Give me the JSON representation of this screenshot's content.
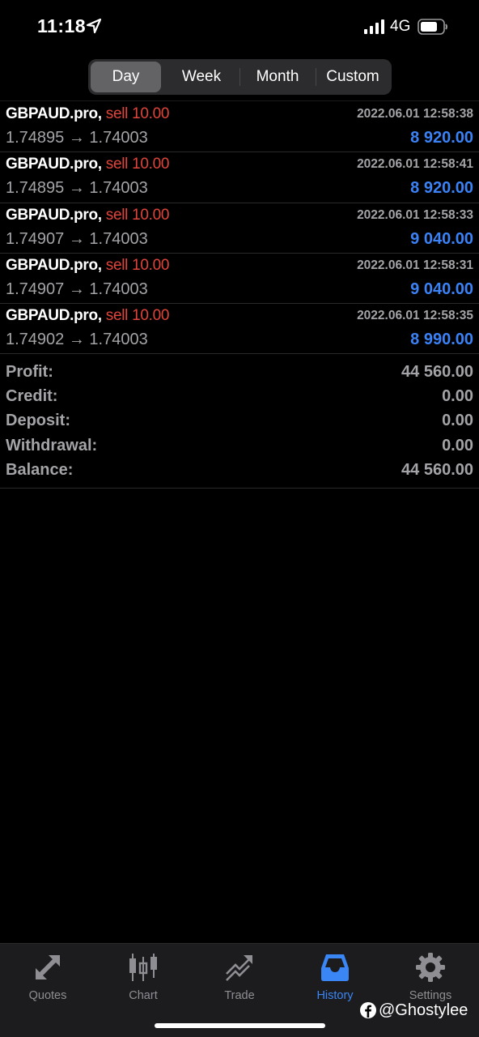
{
  "status_bar": {
    "time": "11:18",
    "network": "4G",
    "icons": [
      "location-arrow-icon",
      "cellular-signal-icon",
      "battery-icon"
    ]
  },
  "period_tabs": [
    "Day",
    "Week",
    "Month",
    "Custom"
  ],
  "period_selected": "Day",
  "trades": [
    {
      "symbol": "GBPAUD.pro,",
      "side": "sell 10.00",
      "time": "2022.06.01 12:58:38",
      "prices": "1.74895 → 1.74003",
      "profit": "8 920.00"
    },
    {
      "symbol": "GBPAUD.pro,",
      "side": "sell 10.00",
      "time": "2022.06.01 12:58:41",
      "prices": "1.74895 → 1.74003",
      "profit": "8 920.00"
    },
    {
      "symbol": "GBPAUD.pro,",
      "side": "sell 10.00",
      "time": "2022.06.01 12:58:33",
      "prices": "1.74907 → 1.74003",
      "profit": "9 040.00"
    },
    {
      "symbol": "GBPAUD.pro,",
      "side": "sell 10.00",
      "time": "2022.06.01 12:58:31",
      "prices": "1.74907 → 1.74003",
      "profit": "9 040.00"
    },
    {
      "symbol": "GBPAUD.pro,",
      "side": "sell 10.00",
      "time": "2022.06.01 12:58:35",
      "prices": "1.74902 → 1.74003",
      "profit": "8 990.00"
    }
  ],
  "summary": [
    {
      "label": "Profit:",
      "value": "44 560.00"
    },
    {
      "label": "Credit:",
      "value": "0.00"
    },
    {
      "label": "Deposit:",
      "value": "0.00"
    },
    {
      "label": "Withdrawal:",
      "value": "0.00"
    },
    {
      "label": "Balance:",
      "value": "44 560.00"
    }
  ],
  "tab_bar": [
    {
      "label": "Quotes",
      "icon": "quotes-arrows-icon"
    },
    {
      "label": "Chart",
      "icon": "candlestick-chart-icon"
    },
    {
      "label": "Trade",
      "icon": "trade-trend-icon"
    },
    {
      "label": "History",
      "icon": "history-inbox-icon"
    },
    {
      "label": "Settings",
      "icon": "gear-icon"
    }
  ],
  "tab_selected": "History",
  "watermark": "@Ghostylee",
  "colors": {
    "sell": "#e0443a",
    "profit": "#3b82f6",
    "active_tab": "#3a86f5",
    "muted_text": "#a4a4a8"
  }
}
